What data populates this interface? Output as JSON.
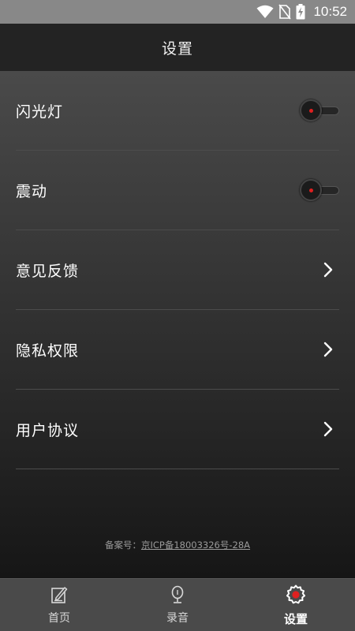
{
  "status_bar": {
    "time": "10:52",
    "icons": [
      "wifi-icon",
      "no-sim-icon",
      "battery-charging-icon"
    ]
  },
  "header": {
    "title": "设置"
  },
  "settings": {
    "items": [
      {
        "label": "闪光灯",
        "control": "toggle",
        "state": "off"
      },
      {
        "label": "震动",
        "control": "toggle",
        "state": "off"
      },
      {
        "label": "意见反馈",
        "control": "chevron"
      },
      {
        "label": "隐私权限",
        "control": "chevron"
      },
      {
        "label": "用户协议",
        "control": "chevron"
      }
    ]
  },
  "footer": {
    "prefix": "备案号：",
    "link": "京ICP备18003326号-28A"
  },
  "tabs": [
    {
      "label": "首页",
      "icon": "edit-note-icon",
      "active": false
    },
    {
      "label": "录音",
      "icon": "microphone-icon",
      "active": false
    },
    {
      "label": "设置",
      "icon": "gear-icon",
      "active": true
    }
  ],
  "colors": {
    "status_bar": "#888888",
    "header_bg": "#232323",
    "tab_bar_bg": "#4a4a4a",
    "toggle_dot": "#e02020",
    "active_gear": "#e02020"
  }
}
